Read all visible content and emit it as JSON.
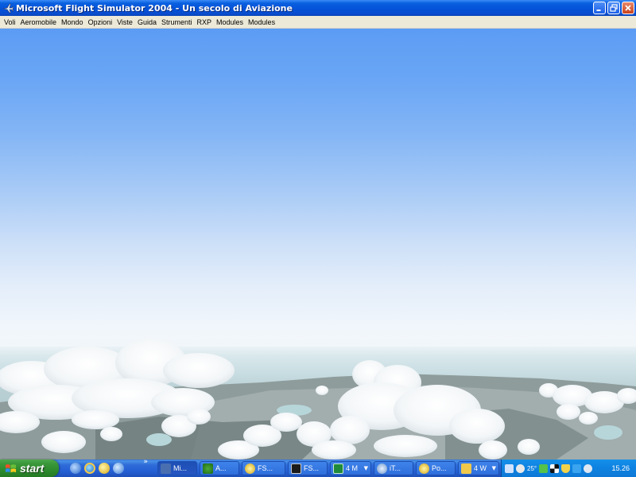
{
  "window": {
    "title": "Microsoft Flight Simulator 2004 - Un secolo di Aviazione",
    "controls": [
      "minimize-icon",
      "restore-icon",
      "close-icon"
    ]
  },
  "menubar": {
    "items": [
      "Voli",
      "Aeromobile",
      "Mondo",
      "Opzioni",
      "Viste",
      "Guida",
      "Strumenti",
      "RXP",
      "Modules",
      "Modules"
    ]
  },
  "viewport": {
    "scene": "sky-and-clouds",
    "colors": {
      "sky_top": "#5c9cf4",
      "horizon": "#eef4fb",
      "ground": "#8a9a9a"
    }
  },
  "taskbar": {
    "start_label": "start",
    "quicklaunch_more": "»",
    "tasks": [
      {
        "label": "Mi...",
        "icon": "plane-icon",
        "active": true,
        "arrow": ""
      },
      {
        "label": "A...",
        "icon": "tree-icon",
        "active": false,
        "arrow": ""
      },
      {
        "label": "FS...",
        "icon": "yellow-circle-icon",
        "active": false,
        "arrow": ""
      },
      {
        "label": "FS...",
        "icon": "monitor-icon",
        "active": false,
        "arrow": ""
      },
      {
        "label": "4 M",
        "icon": "excel-icon",
        "active": false,
        "arrow": "▼"
      },
      {
        "label": "iT...",
        "icon": "itunes-icon",
        "active": false,
        "arrow": ""
      },
      {
        "label": "Po...",
        "icon": "yellow-circle-icon",
        "active": false,
        "arrow": ""
      },
      {
        "label": "4 W",
        "icon": "folder-icon",
        "active": false,
        "arrow": "▼"
      }
    ],
    "tray": {
      "temperature": "25°",
      "clock": "15.26"
    }
  }
}
